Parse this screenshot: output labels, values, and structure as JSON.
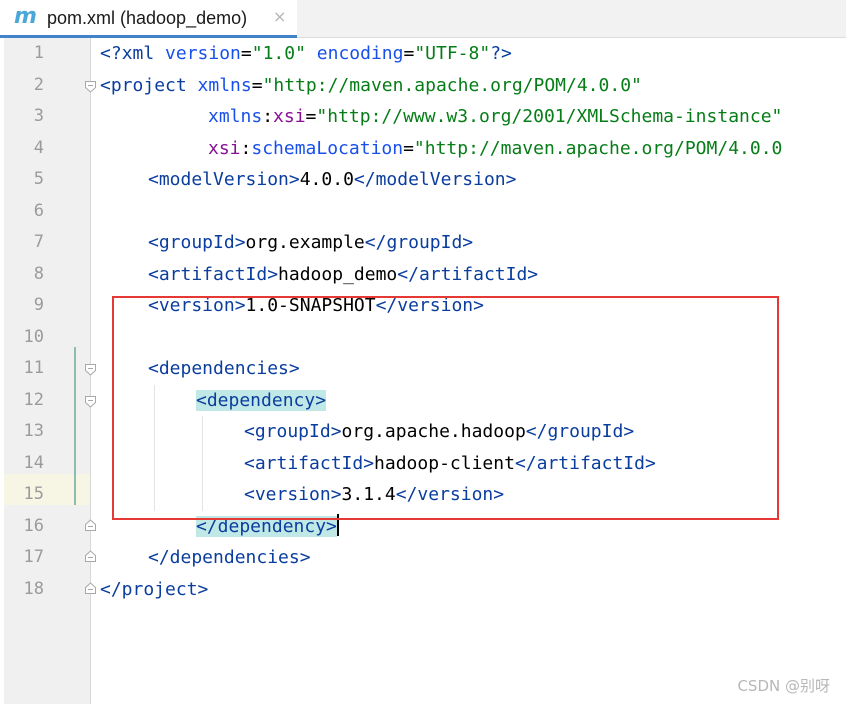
{
  "tab": {
    "icon": "maven-m-icon",
    "icon_glyph": "m",
    "title": "pom.xml (hadoop_demo)",
    "close_glyph": "×"
  },
  "editor": {
    "caret_line": 16,
    "lines": [
      {
        "n": "1"
      },
      {
        "n": "2"
      },
      {
        "n": "3"
      },
      {
        "n": "4"
      },
      {
        "n": "5"
      },
      {
        "n": "6"
      },
      {
        "n": "7"
      },
      {
        "n": "8"
      },
      {
        "n": "9"
      },
      {
        "n": "10"
      },
      {
        "n": "11"
      },
      {
        "n": "12"
      },
      {
        "n": "13"
      },
      {
        "n": "14"
      },
      {
        "n": "15"
      },
      {
        "n": "16"
      },
      {
        "n": "17"
      },
      {
        "n": "18"
      }
    ],
    "text": {
      "l1_open": "<?",
      "l1_xml": "xml",
      "l1_ver_attr": " version",
      "l1_eq1": "=",
      "l1_ver_val": "\"1.0\"",
      "l1_enc_attr": " encoding",
      "l1_eq2": "=",
      "l1_enc_val": "\"UTF-8\"",
      "l1_close": "?>",
      "l2_lt": "<",
      "l2_tag": "project",
      "l2_attr": " xmlns",
      "l2_eq": "=",
      "l2_val": "\"http://maven.apache.org/POM/4.0.0\"",
      "l3_ns": "xmlns",
      "l3_colon": ":",
      "l3_attr": "xsi",
      "l3_eq": "=",
      "l3_val": "\"http://www.w3.org/2001/XMLSchema-instance\"",
      "l4_ns": "xsi",
      "l4_colon": ":",
      "l4_attr": "schemaLocation",
      "l4_eq": "=",
      "l4_val": "\"http://maven.apache.org/POM/4.0.0",
      "l5_open": "<modelVersion>",
      "l5_text": "4.0.0",
      "l5_close": "</modelVersion>",
      "l7_open": "<groupId>",
      "l7_text": "org.example",
      "l7_close": "</groupId>",
      "l8_open": "<artifactId>",
      "l8_text": "hadoop_demo",
      "l8_close": "</artifactId>",
      "l9_open": "<version>",
      "l9_text": "1.0-SNAPSHOT",
      "l9_close": "</version>",
      "l11": "<dependencies>",
      "l12": "<dependency>",
      "l13_open": "<groupId>",
      "l13_text": "org.apache.hadoop",
      "l13_close": "</groupId>",
      "l14_open": "<artifactId>",
      "l14_text": "hadoop-client",
      "l14_close": "</artifactId>",
      "l15_open": "<version>",
      "l15_text": "3.1.4",
      "l15_close": "</version>",
      "l16": "</dependency>",
      "l17": "</dependencies>",
      "l18": "</project>"
    }
  },
  "annotation": {
    "box_color": "#e53935",
    "covers_lines": "11-16"
  },
  "watermark": "CSDN @别呀",
  "colors": {
    "tag": "#0a3d9e",
    "attribute": "#1750eb",
    "namespace": "#871094",
    "string": "#067d17",
    "tag_match_highlight": "#c0e8e6",
    "caret_row": "#fcfaed"
  }
}
